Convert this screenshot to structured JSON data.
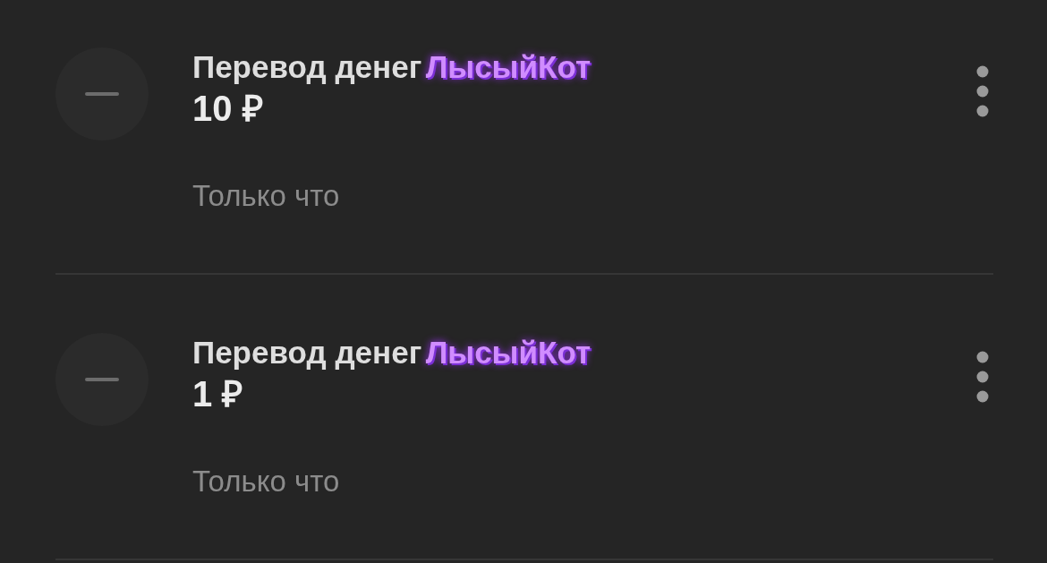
{
  "transactions": [
    {
      "title": "Перевод денег",
      "sender": "ЛысыйКот",
      "amount": "10 ₽",
      "time": "Только что"
    },
    {
      "title": "Перевод денег",
      "sender": "ЛысыйКот",
      "amount": "1 ₽",
      "time": "Только что"
    }
  ]
}
